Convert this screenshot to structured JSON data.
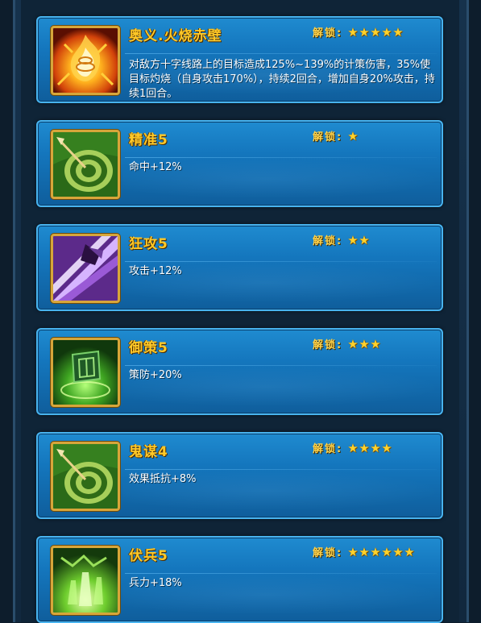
{
  "unlock_label": "解锁:",
  "skills": [
    {
      "title": "奥义.火烧赤壁",
      "stars": 5,
      "desc": "对敌方十字线路上的目标造成125%~139%的计策伤害，35%使目标灼烧（自身攻击170%），持续2回合，增加自身20%攻击，持续1回合。",
      "icon": "fire-scroll-icon"
    },
    {
      "title": "精准5",
      "stars": 1,
      "desc": "命中+12%",
      "icon": "target-arrow-icon"
    },
    {
      "title": "狂攻5",
      "stars": 2,
      "desc": "攻击+12%",
      "icon": "purple-slash-icon"
    },
    {
      "title": "御策5",
      "stars": 3,
      "desc": "策防+20%",
      "icon": "green-shield-icon"
    },
    {
      "title": "鬼谋4",
      "stars": 4,
      "desc": "效果抵抗+8%",
      "icon": "target-arrow-icon"
    },
    {
      "title": "伏兵5",
      "stars": 6,
      "desc": "兵力+18%",
      "icon": "green-troops-icon"
    }
  ]
}
